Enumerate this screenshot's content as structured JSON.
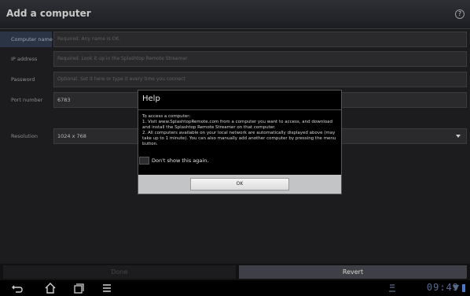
{
  "header": {
    "title": "Add a computer",
    "help_icon": "help-circle-icon"
  },
  "form": {
    "computer_name": {
      "label": "Computer name",
      "placeholder": "Required. Any name is OK."
    },
    "ip_address": {
      "label": "IP address",
      "placeholder": "Required. Look it up in the Splashtop Remote Streamer"
    },
    "password": {
      "label": "Password",
      "placeholder": "Optional. Set it here or type it every time you connect"
    },
    "port_number": {
      "label": "Port number",
      "value": "6783"
    },
    "resolution": {
      "label": "Resolution",
      "value": "1024 x 768"
    }
  },
  "dialog": {
    "title": "Help",
    "line1": "To access a computer:",
    "line2": "1. Visit www.SplashtopRemote.com from a computer you want to access, and download and install the Splashtop Remote Streamer on that computer.",
    "line3": "2. All computers available on your local network are automatically displayed above (may take up to 1 minute). You can also manually add another computer by pressing the menu button.",
    "checkbox_label": "Don't show this again.",
    "ok_label": "OK"
  },
  "actions": {
    "done_label": "Done",
    "revert_label": "Revert"
  },
  "system": {
    "clock": "09:49"
  }
}
